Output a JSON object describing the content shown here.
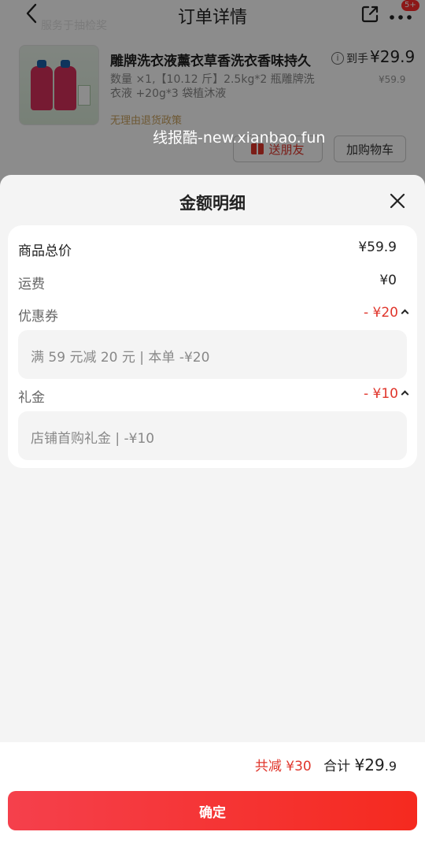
{
  "background": {
    "nav_title": "订单详情",
    "more_badge": "5+",
    "faint_tag": "服务于抽检奖",
    "product": {
      "name": "雕牌洗衣液薰衣草香洗衣香味持久",
      "spec": "数量 ×1,【10.12 斤】2.5kg*2 瓶雕牌洗衣液 +20g*3 袋植沐液",
      "price_label": "到手",
      "price_final": "¥29.9",
      "price_original": "¥59.9",
      "policy": "无理由退货政策"
    },
    "watermark": "线报酷-new.xianbao.fun",
    "gift_button": "送朋友",
    "cart_button": "加购物车"
  },
  "sheet": {
    "title": "金额明细",
    "rows": {
      "goods_total": {
        "label": "商品总价",
        "value": "¥59.9"
      },
      "shipping": {
        "label": "运费",
        "value": "¥0"
      },
      "coupon": {
        "label": "优惠券",
        "value": "- ¥20",
        "detail": "满 59 元减 20 元 | 本单 -¥20"
      },
      "gift_money": {
        "label": "礼金",
        "value": "- ¥10",
        "detail": "店铺首购礼金 | -¥10"
      }
    },
    "footer": {
      "saved": "共减 ¥30",
      "total_label": "合计",
      "total_amount": "¥29",
      "total_decimal": ".9",
      "confirm": "确定"
    }
  },
  "colors": {
    "accent_red": "#e0352b",
    "button_gradient_start": "#f5404c",
    "button_gradient_end": "#f52a1f"
  },
  "icons": [
    "back-arrow-icon",
    "share-icon",
    "more-icon",
    "info-icon",
    "gift-icon",
    "close-icon",
    "chevron-up-icon"
  ]
}
